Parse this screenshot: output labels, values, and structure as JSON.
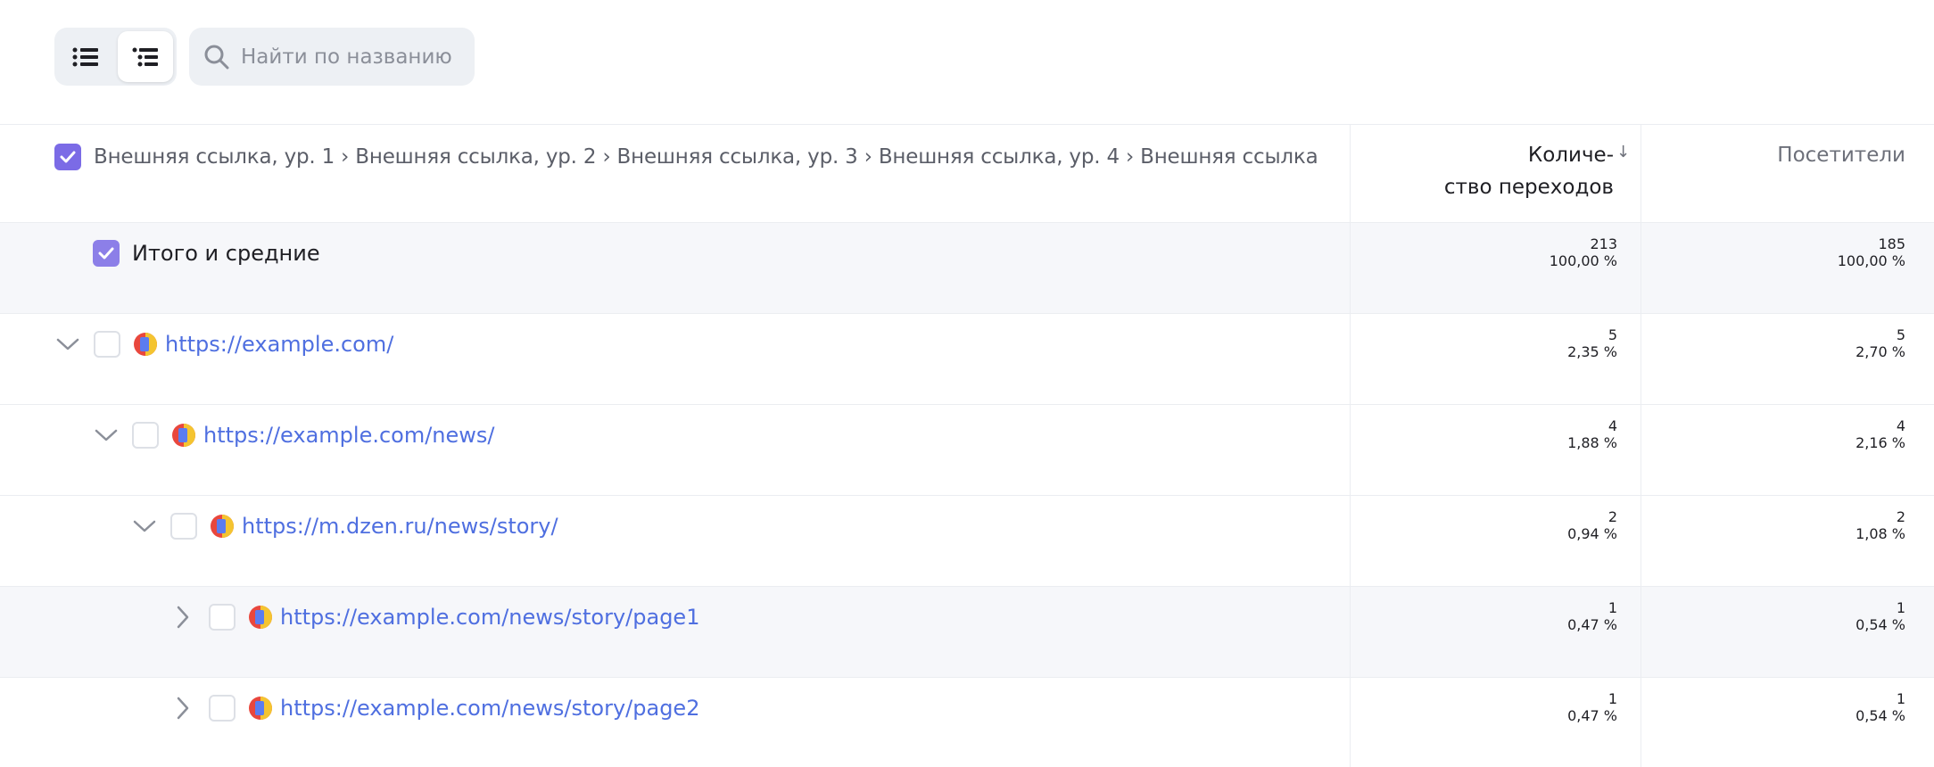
{
  "toolbar": {
    "search_placeholder": "Найти по названию"
  },
  "table": {
    "header": {
      "dimension_path": "Внешняя ссылка, ур. 1 › Внешняя ссылка, ур. 2 › Внешняя ссылка, ур. 3 › Внешняя ссылка, ур. 4 › Внешняя ссылка",
      "col_visits_line1": "Количе-",
      "col_visits_line2": "ство переходов",
      "col_visits_sort": "↓",
      "col_visitors": "Посетители"
    },
    "total": {
      "label": "Итого и средние",
      "visits": "213",
      "visits_pct": "100,00 %",
      "visitors": "185",
      "visitors_pct": "100,00 %"
    },
    "rows": [
      {
        "url": "https://example.com/",
        "visits": "5",
        "visits_pct": "2,35 %",
        "visitors": "5",
        "visitors_pct": "2,70 %"
      },
      {
        "url": "https://example.com/news/",
        "visits": "4",
        "visits_pct": "1,88 %",
        "visitors": "4",
        "visitors_pct": "2,16 %"
      },
      {
        "url": "https://m.dzen.ru/news/story/",
        "visits": "2",
        "visits_pct": "0,94 %",
        "visitors": "2",
        "visitors_pct": "1,08 %"
      },
      {
        "url": "https://example.com/news/story/page1",
        "visits": "1",
        "visits_pct": "0,47 %",
        "visitors": "1",
        "visitors_pct": "0,54 %"
      },
      {
        "url": "https://example.com/news/story/page2",
        "visits": "1",
        "visits_pct": "0,47 %",
        "visitors": "1",
        "visitors_pct": "0,54 %"
      }
    ]
  },
  "colors": {
    "accent": "#7b6be6",
    "link": "#4f6fe0"
  }
}
